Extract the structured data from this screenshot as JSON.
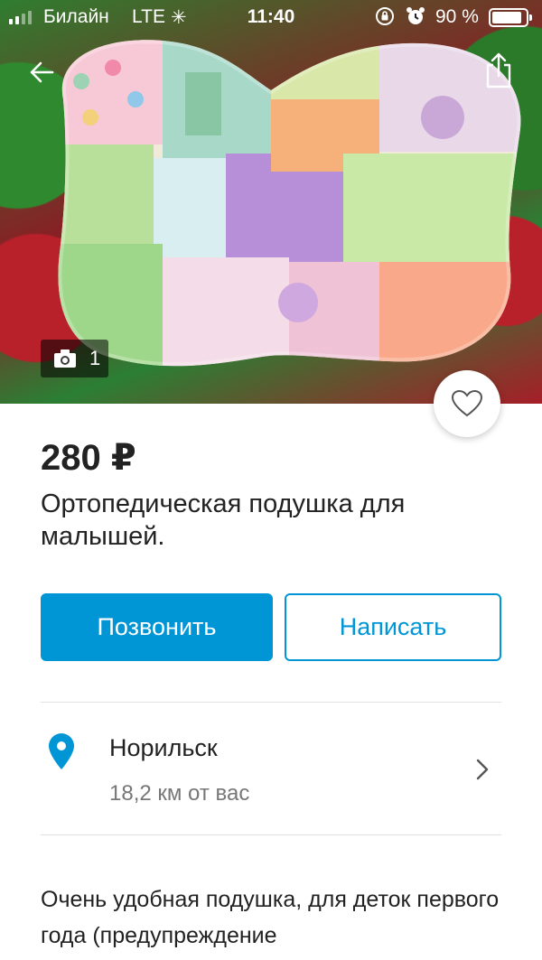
{
  "status_bar": {
    "carrier": "Билайн",
    "network": "LTE",
    "time": "11:40",
    "battery_percent": "90 %",
    "battery_level": 0.9
  },
  "photo": {
    "count": "1"
  },
  "listing": {
    "price": "280 ₽",
    "title": "Ортопедическая  подушка для малышей."
  },
  "actions": {
    "call_label": "Позвонить",
    "write_label": "Написать"
  },
  "location": {
    "city": "Норильск",
    "distance": "18,2  км от вас"
  },
  "description": "Очень удобная подушка, для деток первого года (предупреждение",
  "colors": {
    "accent": "#0096d6",
    "pin": "#0096d6",
    "text": "#222222",
    "muted": "#777777"
  },
  "icons": [
    "back-arrow-icon",
    "share-icon",
    "camera-icon",
    "heart-icon",
    "location-pin-icon",
    "chevron-right-icon"
  ]
}
